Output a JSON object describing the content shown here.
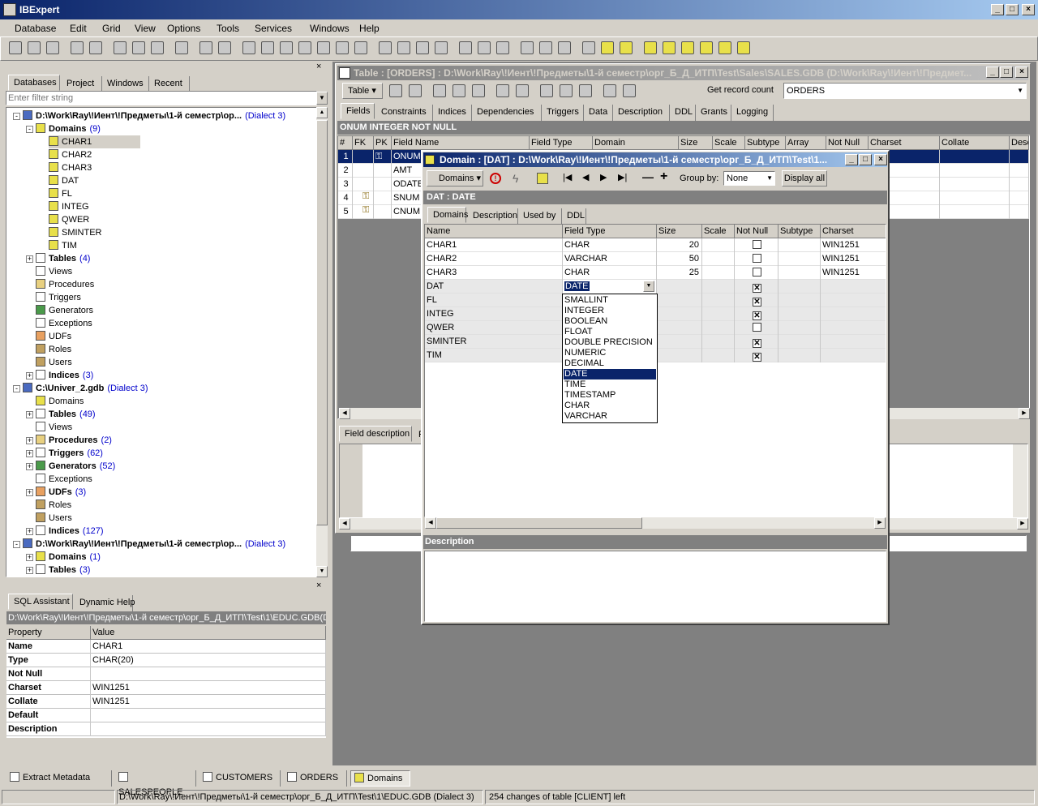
{
  "app": {
    "title": "IBExpert",
    "menu": [
      "Database",
      "Edit",
      "Grid",
      "View",
      "Options",
      "Tools",
      "Services",
      "Windows",
      "Help"
    ]
  },
  "left_panel": {
    "tabs": [
      "Databases",
      "Project",
      "Windows",
      "Recent"
    ],
    "filter_placeholder": "Enter filter string",
    "tree": [
      {
        "label": "D:\\Work\\Ray\\!Иент\\!Предметы\\1-й семестр\\ор...",
        "note": "(Dialect 3)",
        "level": 0,
        "bold": true,
        "exp": "-"
      },
      {
        "label": "Domains",
        "note": "(9)",
        "level": 1,
        "bold": true,
        "exp": "-",
        "icon": "domain-icon"
      },
      {
        "label": "CHAR1",
        "level": 2,
        "icon": "domain-icon",
        "selected": true
      },
      {
        "label": "CHAR2",
        "level": 2,
        "icon": "domain-icon"
      },
      {
        "label": "CHAR3",
        "level": 2,
        "icon": "domain-icon"
      },
      {
        "label": "DAT",
        "level": 2,
        "icon": "domain-icon"
      },
      {
        "label": "FL",
        "level": 2,
        "icon": "domain-icon"
      },
      {
        "label": "INTEG",
        "level": 2,
        "icon": "domain-icon"
      },
      {
        "label": "QWER",
        "level": 2,
        "icon": "domain-icon"
      },
      {
        "label": "SMINTER",
        "level": 2,
        "icon": "domain-icon"
      },
      {
        "label": "TIM",
        "level": 2,
        "icon": "domain-icon"
      },
      {
        "label": "Tables",
        "note": "(4)",
        "level": 1,
        "bold": true,
        "exp": "+",
        "icon": "table-icon"
      },
      {
        "label": "Views",
        "level": 1,
        "icon": "view-icon"
      },
      {
        "label": "Procedures",
        "level": 1,
        "icon": "procedure-icon"
      },
      {
        "label": "Triggers",
        "level": 1,
        "icon": "trigger-icon"
      },
      {
        "label": "Generators",
        "level": 1,
        "icon": "generator-icon"
      },
      {
        "label": "Exceptions",
        "level": 1,
        "icon": "exception-icon"
      },
      {
        "label": "UDFs",
        "level": 1,
        "icon": "udf-icon"
      },
      {
        "label": "Roles",
        "level": 1,
        "icon": "role-icon"
      },
      {
        "label": "Users",
        "level": 1,
        "icon": "user-icon"
      },
      {
        "label": "Indices",
        "note": "(3)",
        "level": 1,
        "bold": true,
        "exp": "+",
        "icon": "index-icon"
      },
      {
        "label": "C:\\Univer_2.gdb",
        "note": "(Dialect 3)",
        "level": 0,
        "bold": true,
        "exp": "-"
      },
      {
        "label": "Domains",
        "level": 1,
        "icon": "domain-icon"
      },
      {
        "label": "Tables",
        "note": "(49)",
        "level": 1,
        "bold": true,
        "exp": "+",
        "icon": "table-icon"
      },
      {
        "label": "Views",
        "level": 1,
        "icon": "view-icon"
      },
      {
        "label": "Procedures",
        "note": "(2)",
        "level": 1,
        "bold": true,
        "exp": "+",
        "icon": "procedure-icon"
      },
      {
        "label": "Triggers",
        "note": "(62)",
        "level": 1,
        "bold": true,
        "exp": "+",
        "icon": "trigger-icon"
      },
      {
        "label": "Generators",
        "note": "(52)",
        "level": 1,
        "bold": true,
        "exp": "+",
        "icon": "generator-icon"
      },
      {
        "label": "Exceptions",
        "level": 1,
        "icon": "exception-icon"
      },
      {
        "label": "UDFs",
        "note": "(3)",
        "level": 1,
        "bold": true,
        "exp": "+",
        "icon": "udf-icon"
      },
      {
        "label": "Roles",
        "level": 1,
        "icon": "role-icon"
      },
      {
        "label": "Users",
        "level": 1,
        "icon": "user-icon"
      },
      {
        "label": "Indices",
        "note": "(127)",
        "level": 1,
        "bold": true,
        "exp": "+",
        "icon": "index-icon"
      },
      {
        "label": "D:\\Work\\Ray\\!Иент\\!Предметы\\1-й семестр\\ор...",
        "note": "(Dialect 3)",
        "level": 0,
        "bold": true,
        "exp": "-"
      },
      {
        "label": "Domains",
        "note": "(1)",
        "level": 1,
        "bold": true,
        "exp": "+",
        "icon": "domain-icon"
      },
      {
        "label": "Tables",
        "note": "(3)",
        "level": 1,
        "bold": true,
        "exp": "+",
        "icon": "table-icon"
      }
    ]
  },
  "sql_assistant": {
    "tabs": [
      "SQL Assistant",
      "Dynamic Help"
    ],
    "path": "D:\\Work\\Ray\\!Иент\\!Предметы\\1-й семестр\\орг_Б_Д_ИТП\\Test\\1\\EDUC.GDB(D",
    "headers": [
      "Property",
      "Value"
    ],
    "rows": [
      [
        "Name",
        "CHAR1"
      ],
      [
        "Type",
        "CHAR(20)"
      ],
      [
        "Not Null",
        ""
      ],
      [
        "Charset",
        "WIN1251"
      ],
      [
        "Collate",
        "WIN1251"
      ],
      [
        "Default",
        ""
      ],
      [
        "Description",
        ""
      ]
    ]
  },
  "table_window": {
    "title": "Table : [ORDERS] : D:\\Work\\Ray\\!Иент\\!Предметы\\1-й семестр\\орг_Б_Д_ИТП\\Test\\Sales\\SALES.GDB (D:\\Work\\Ray\\!Иент\\!Предмет...",
    "table_menu": "Table",
    "get_record_count": "Get record count",
    "table_name": "ORDERS",
    "tabs": [
      "Fields",
      "Constraints",
      "Indices",
      "Dependencies",
      "Triggers",
      "Data",
      "Description",
      "DDL",
      "Grants",
      "Logging"
    ],
    "info": "ONUM INTEGER NOT NULL",
    "headers": [
      "#",
      "FK",
      "PK",
      "Field Name",
      "Field Type",
      "Domain",
      "Size",
      "Scale",
      "Subtype",
      "Array",
      "Not Null",
      "Charset",
      "Collate",
      "Desc"
    ],
    "rows": [
      [
        "1",
        "",
        "key",
        "ONUM"
      ],
      [
        "2",
        "",
        "",
        "AMT"
      ],
      [
        "3",
        "",
        "",
        "ODATE"
      ],
      [
        "4",
        "fk",
        "",
        "SNUM"
      ],
      [
        "5",
        "fk",
        "",
        "CNUM"
      ]
    ],
    "bottom_tabs": [
      "Field description",
      "F"
    ]
  },
  "domain_window": {
    "title": "Domain : [DAT] : D:\\Work\\Ray\\!Иент\\!Предметы\\1-й семестр\\орг_Б_Д_ИТП\\Test\\1...",
    "menu_label": "Domains",
    "group_by_label": "Group by:",
    "group_by_value": "None",
    "display_all": "Display all",
    "info": "DAT : DATE",
    "tabs": [
      "Domains",
      "Description",
      "Used by",
      "DDL"
    ],
    "headers": [
      "Name",
      "Field Type",
      "Size",
      "Scale",
      "Not Null",
      "Subtype",
      "Charset"
    ],
    "rows": [
      {
        "name": "CHAR1",
        "type": "CHAR",
        "size": "20",
        "notnull": false,
        "charset": "WIN1251"
      },
      {
        "name": "CHAR2",
        "type": "VARCHAR",
        "size": "50",
        "notnull": false,
        "charset": "WIN1251"
      },
      {
        "name": "CHAR3",
        "type": "CHAR",
        "size": "25",
        "notnull": false,
        "charset": "WIN1251"
      },
      {
        "name": "DAT",
        "type": "DATE",
        "size": "",
        "notnull": true,
        "charset": ""
      },
      {
        "name": "FL",
        "type": "",
        "size": "",
        "notnull": true,
        "charset": ""
      },
      {
        "name": "INTEG",
        "type": "",
        "size": "",
        "notnull": true,
        "charset": ""
      },
      {
        "name": "QWER",
        "type": "",
        "size": "",
        "notnull": false,
        "charset": ""
      },
      {
        "name": "SMINTER",
        "type": "",
        "size": "",
        "notnull": true,
        "charset": ""
      },
      {
        "name": "TIM",
        "type": "",
        "size": "",
        "notnull": true,
        "charset": ""
      }
    ],
    "dropdown_options": [
      "SMALLINT",
      "INTEGER",
      "BOOLEAN",
      "FLOAT",
      "DOUBLE PRECISION",
      "NUMERIC",
      "DECIMAL",
      "DATE",
      "TIME",
      "TIMESTAMP",
      "CHAR",
      "VARCHAR"
    ],
    "dropdown_selected": "DATE",
    "description_label": "Description"
  },
  "taskbar": [
    "Extract Metadata",
    "SALESPEOPLE",
    "CUSTOMERS",
    "ORDERS",
    "Domains"
  ],
  "status": {
    "path": "D:\\Work\\Ray\\!Иент\\!Предметы\\1-й семестр\\орг_Б_Д_ИТП\\Test\\1\\EDUC.GDB (Dialect 3)",
    "message": "254 changes of table [CLIENT] left"
  },
  "colors": {
    "titlebar": "#0a246a",
    "titlebar_inactive": "#808080",
    "selection": "#0a246a",
    "mdi_bg": "#808080"
  }
}
